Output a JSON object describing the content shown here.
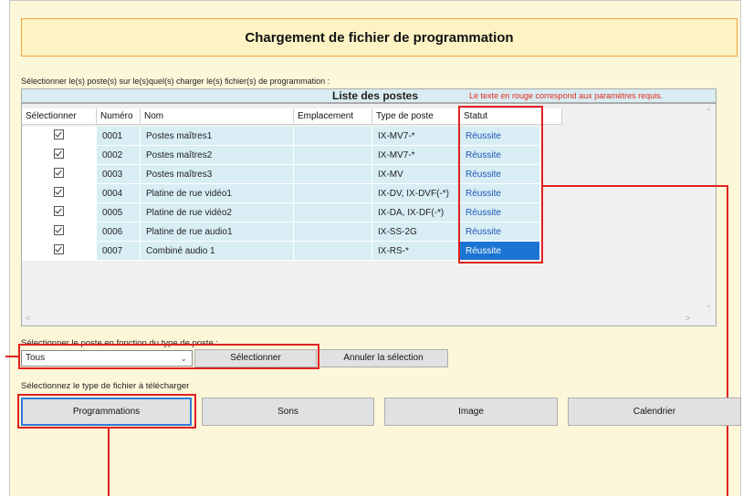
{
  "page": {
    "title": "Chargement de fichier de programmation"
  },
  "instruction": "Sélectionner le(s) poste(s) sur le(s)quel(s) charger le(s) fichier(s) de programmation :",
  "list": {
    "title": "Liste des postes",
    "note": "Le texte en rouge correspond aux paramètres requis.",
    "columns": [
      "Sélectionner",
      "Numéro",
      "Nom",
      "Emplacement",
      "Type de poste",
      "Statut"
    ],
    "rows": [
      {
        "numero": "0001",
        "nom": "Postes maîtres1",
        "emplacement": "",
        "type": "IX-MV7-*",
        "statut": "Réussite"
      },
      {
        "numero": "0002",
        "nom": "Postes maîtres2",
        "emplacement": "",
        "type": "IX-MV7-*",
        "statut": "Réussite"
      },
      {
        "numero": "0003",
        "nom": "Postes maîtres3",
        "emplacement": "",
        "type": "IX-MV",
        "statut": "Réussite"
      },
      {
        "numero": "0004",
        "nom": "Platine de rue vidéo1",
        "emplacement": "",
        "type": "IX-DV, IX-DVF(-*)",
        "statut": "Réussite"
      },
      {
        "numero": "0005",
        "nom": "Platine de rue vidéo2",
        "emplacement": "",
        "type": "IX-DA, IX-DF(-*)",
        "statut": "Réussite"
      },
      {
        "numero": "0006",
        "nom": "Platine de rue audio1",
        "emplacement": "",
        "type": "IX-SS-2G",
        "statut": "Réussite"
      },
      {
        "numero": "0007",
        "nom": "Combiné audio 1",
        "emplacement": "",
        "type": "IX-RS-*",
        "statut": "Réussite"
      }
    ]
  },
  "filter": {
    "label": "Sélectionner le poste en fonction du type de poste :",
    "selected": "Tous",
    "select_button": "Sélectionner",
    "clear_button": "Annuler la sélection"
  },
  "filetype": {
    "label": "Sélectionnez le type de fichier à télécharger",
    "buttons": [
      "Programmations",
      "Sons",
      "Image",
      "Calendrier"
    ]
  },
  "colors": {
    "status_text": "#1f55b8",
    "highlight": "#1a74d1",
    "callout": "#e1211f",
    "note": "#e52b1f"
  }
}
